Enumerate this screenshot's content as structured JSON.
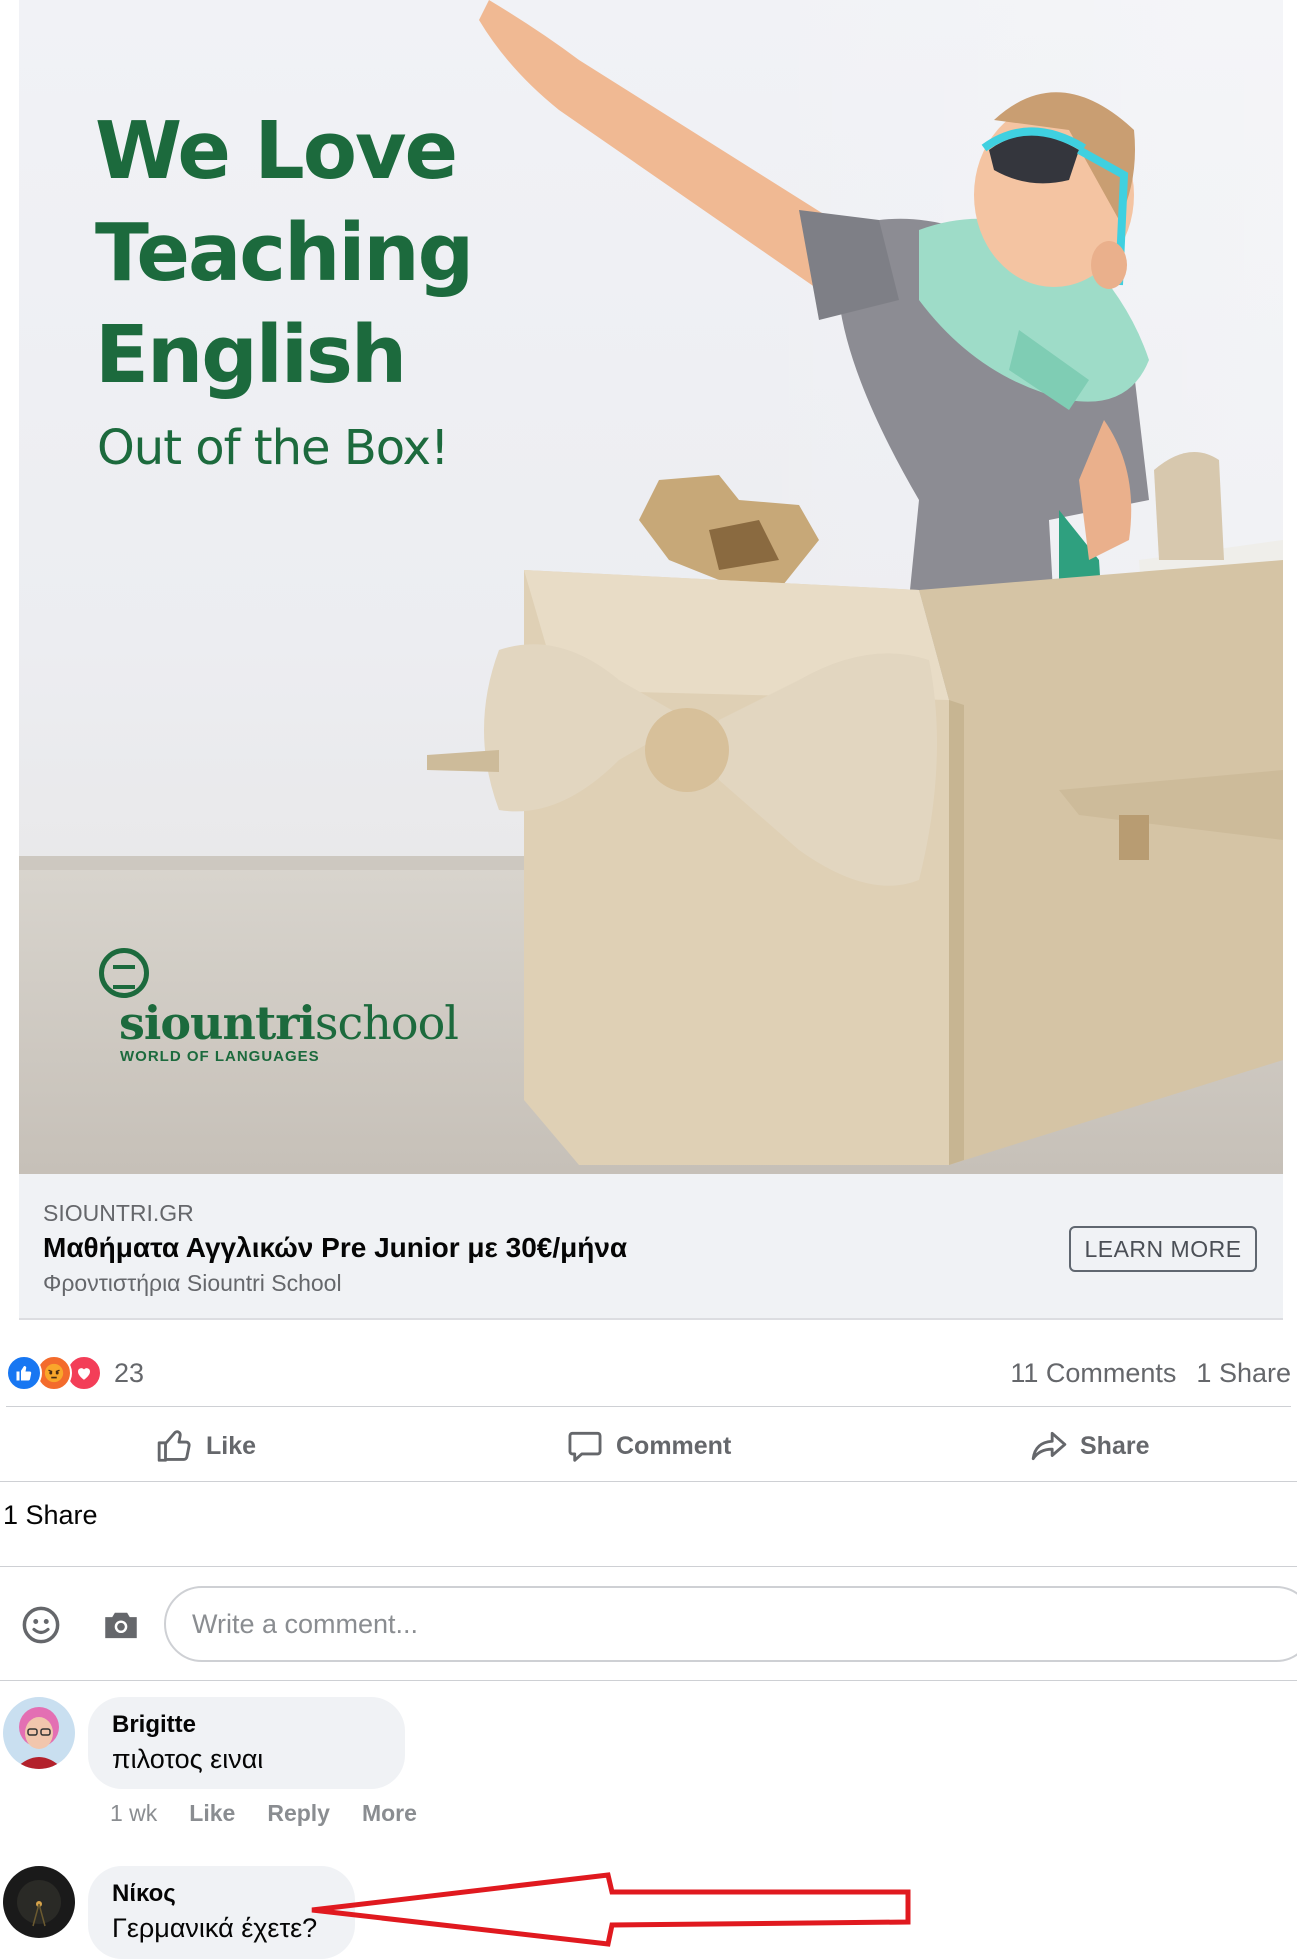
{
  "ad": {
    "headline": "We Love\nTeaching\nEnglish",
    "subheadline": "Out of the Box!",
    "logo_brand_bold": "siountri",
    "logo_brand_light": "school",
    "logo_tagline": "WORLD OF LANGUAGES"
  },
  "link": {
    "domain": "SIOUNTRI.GR",
    "title": "Μαθήματα Αγγλικών Pre Junior με 30€/μήνα",
    "description": "Φροντιστήρια Siountri School",
    "cta": "LEARN MORE"
  },
  "stats": {
    "reactions": [
      "like",
      "angry",
      "love"
    ],
    "reaction_count": "23",
    "comments": "11 Comments",
    "shares": "1 Share"
  },
  "actions": {
    "like": "Like",
    "comment": "Comment",
    "share": "Share"
  },
  "share_line": "1 Share",
  "composer": {
    "placeholder": "Write a comment..."
  },
  "comments": [
    {
      "name": "Brigitte",
      "text": "πιλοτος ειναι",
      "time": "1 wk",
      "like": "Like",
      "reply": "Reply",
      "more": "More"
    },
    {
      "name": "Νίκος",
      "text": "Γερμανικά έχετε?"
    }
  ],
  "colors": {
    "brand_green": "#1c6a3d",
    "facebook_blue": "#1877f2",
    "annotation_red": "#e0191f"
  }
}
